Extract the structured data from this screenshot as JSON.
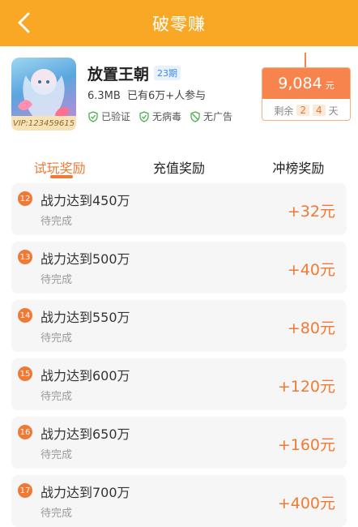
{
  "header": {
    "title": "破零赚"
  },
  "app": {
    "name": "放置王朝",
    "period": "23期",
    "size": "6.3MB",
    "participants": "已有6万+人参与",
    "vip": "VIP:123459615",
    "badges": [
      "已验证",
      "无病毒",
      "无广告"
    ]
  },
  "reward": {
    "amount": "9,084",
    "unit": "元",
    "remaining_label": "剩余",
    "days_a": "2",
    "days_b": "4",
    "days_suffix": "天"
  },
  "tabs": [
    {
      "label": "试玩奖励",
      "active": true
    },
    {
      "label": "充值奖励",
      "active": false
    },
    {
      "label": "冲榜奖励",
      "active": false
    }
  ],
  "tasks": [
    {
      "num": "12",
      "name": "战力达到450万",
      "status": "待完成",
      "amount": "+32元"
    },
    {
      "num": "13",
      "name": "战力达到500万",
      "status": "待完成",
      "amount": "+40元"
    },
    {
      "num": "14",
      "name": "战力达到550万",
      "status": "待完成",
      "amount": "+80元"
    },
    {
      "num": "15",
      "name": "战力达到600万",
      "status": "待完成",
      "amount": "+120元"
    },
    {
      "num": "16",
      "name": "战力达到650万",
      "status": "待完成",
      "amount": "+160元"
    },
    {
      "num": "17",
      "name": "战力达到700万",
      "status": "待完成",
      "amount": "+400元"
    }
  ],
  "colors": {
    "header": "#f9a825",
    "accent": "#f07a35"
  }
}
